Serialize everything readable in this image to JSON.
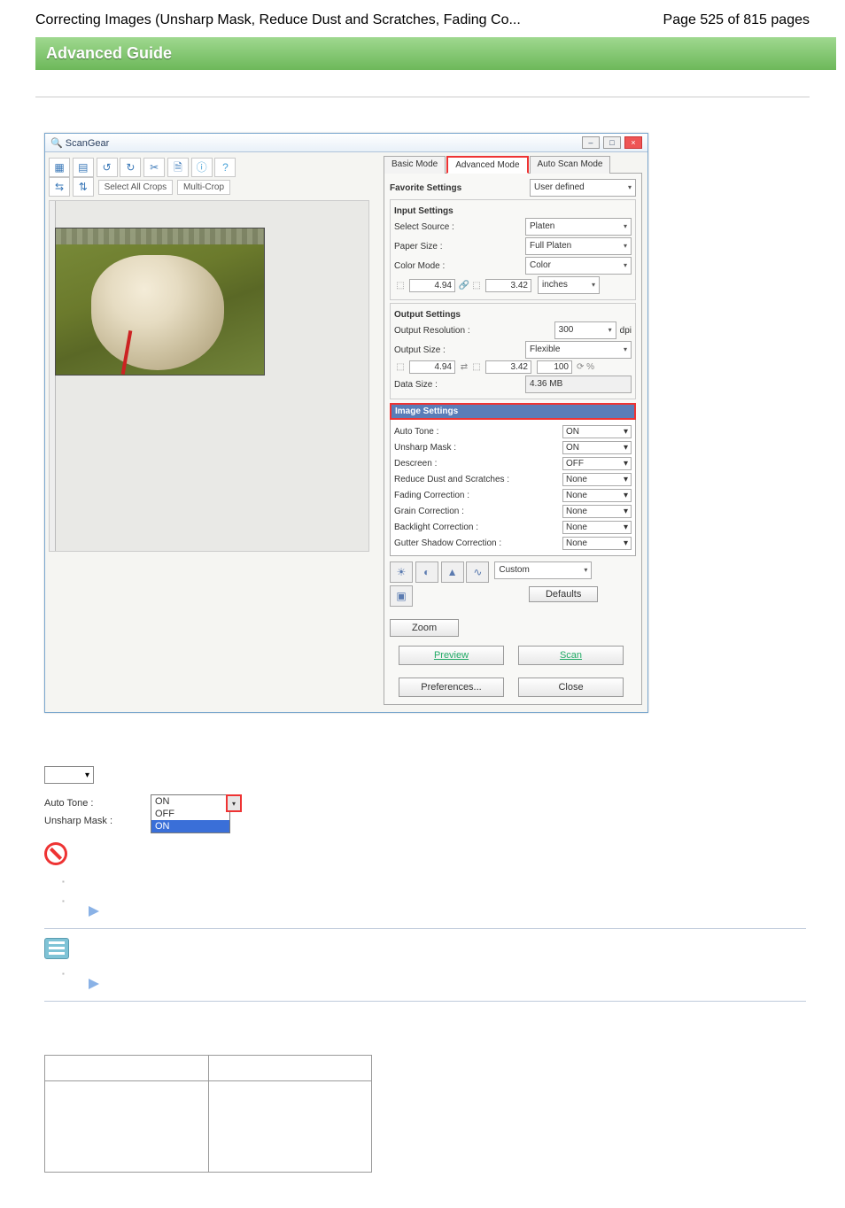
{
  "header": {
    "left": "Correcting Images (Unsharp Mask, Reduce Dust and Scratches, Fading Co...",
    "right": "Page 525 of 815 pages",
    "banner": "Advanced Guide"
  },
  "scangear": {
    "title": "ScanGear",
    "toolbar": {
      "select_all_crops": "Select All Crops",
      "multi_crop": "Multi-Crop"
    },
    "tabs": {
      "basic": "Basic Mode",
      "advanced": "Advanced Mode",
      "auto": "Auto Scan Mode"
    },
    "favorite": {
      "label": "Favorite Settings",
      "value": "User defined"
    },
    "input": {
      "title": "Input Settings",
      "source_lbl": "Select Source :",
      "source_val": "Platen",
      "paper_lbl": "Paper Size :",
      "paper_val": "Full Platen",
      "color_lbl": "Color Mode :",
      "color_val": "Color",
      "w": "4.94",
      "h": "3.42",
      "unit": "inches"
    },
    "output": {
      "title": "Output Settings",
      "res_lbl": "Output Resolution :",
      "res_val": "300",
      "res_unit": "dpi",
      "size_lbl": "Output Size :",
      "size_val": "Flexible",
      "w": "4.94",
      "h": "3.42",
      "pct": "100",
      "data_lbl": "Data Size :",
      "data_val": "4.36 MB"
    },
    "image": {
      "title": "Image Settings",
      "rows": [
        {
          "l": "Auto Tone :",
          "v": "ON"
        },
        {
          "l": "Unsharp Mask :",
          "v": "ON"
        },
        {
          "l": "Descreen :",
          "v": "OFF"
        },
        {
          "l": "Reduce Dust and Scratches :",
          "v": "None"
        },
        {
          "l": "Fading Correction :",
          "v": "None"
        },
        {
          "l": "Grain Correction :",
          "v": "None"
        },
        {
          "l": "Backlight Correction :",
          "v": "None"
        },
        {
          "l": "Gutter Shadow Correction :",
          "v": "None"
        }
      ]
    },
    "adjust": {
      "custom": "Custom",
      "defaults": "Defaults"
    },
    "buttons": {
      "zoom": "Zoom",
      "preview": "Preview",
      "scan": "Scan",
      "prefs": "Preferences...",
      "close": "Close"
    }
  },
  "lower": {
    "auto_tone": "Auto Tone :",
    "unsharp": "Unsharp Mask :",
    "opts": {
      "on": "ON",
      "off": "OFF",
      "on2": "ON"
    }
  }
}
